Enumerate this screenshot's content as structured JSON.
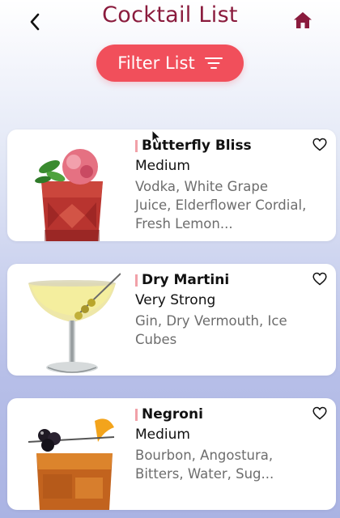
{
  "header": {
    "title": "Cocktail List",
    "back_icon": "chevron-left-icon",
    "home_icon": "home-icon"
  },
  "filter": {
    "label": "Filter List",
    "icon": "filter-lines-icon"
  },
  "colors": {
    "title": "#8a1b3d",
    "button": "#f14f5b",
    "accent_bar": "#f1a1a8"
  },
  "cocktails": [
    {
      "name": "Butterfly Bliss",
      "strength": "Medium",
      "ingredients": "Vodka, White Grape Juice, Elderflower Cordial, Fresh Lemon..."
    },
    {
      "name": "Dry Martini",
      "strength": "Very Strong",
      "ingredients": "Gin, Dry Vermouth, Ice Cubes"
    },
    {
      "name": "Negroni",
      "strength": "Medium",
      "ingredients": "Bourbon, Angostura, Bitters, Water, Sug..."
    }
  ]
}
